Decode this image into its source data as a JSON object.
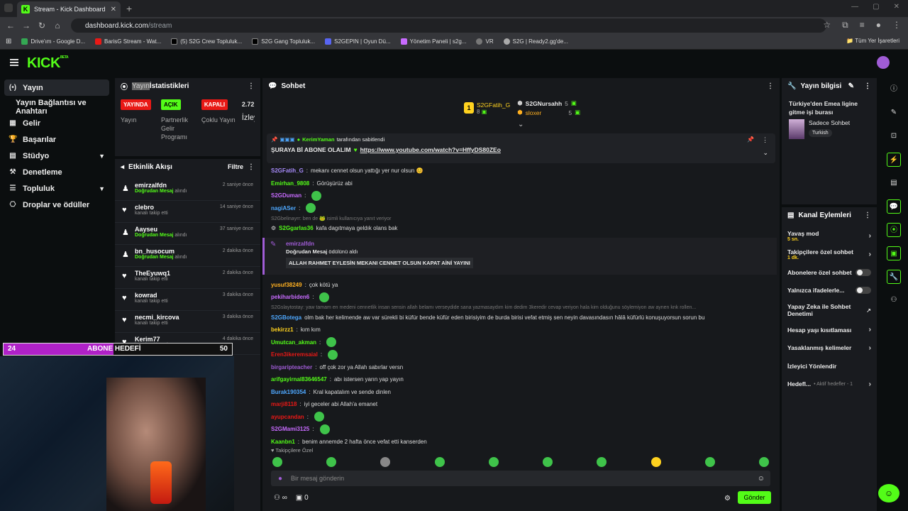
{
  "browser": {
    "tab_title": "Stream - Kick Dashboard",
    "url_host": "dashboard.kick.com",
    "url_path": "/stream",
    "bookmarks": [
      "Drive'ım - Google D...",
      "BarisG Stream - Wat...",
      "(5) S2G Crew Topluluk...",
      "S2G Gang Topluluk...",
      "S2GEPIN | Oyun Dü...",
      "Yönetim Paneli | s2g...",
      "VR",
      "S2G | Ready2.gg'de..."
    ],
    "all_bookmarks": "Tüm Yer İşaretleri"
  },
  "header": {
    "logo": "KICK",
    "logo_sup": "BETA"
  },
  "nav": {
    "items": [
      {
        "label": "Yayın",
        "icon": "(•)"
      },
      {
        "label": "Yayın Bağlantısı ve Anahtarı",
        "icon": ""
      },
      {
        "label": "Gelir",
        "icon": "▦"
      },
      {
        "label": "Başarılar",
        "icon": "🏆"
      },
      {
        "label": "Stüdyo",
        "icon": "▤"
      },
      {
        "label": "Denetleme",
        "icon": "⚒"
      },
      {
        "label": "Topluluk",
        "icon": "☰"
      },
      {
        "label": "Droplar ve ödüller",
        "icon": "⎔"
      }
    ]
  },
  "stats": {
    "title_dim": "Yayın",
    "title": "İstatistikleri",
    "badges": [
      {
        "text": "YAYINDA",
        "bg": "#e91916",
        "fg": "#ffffff",
        "label": "Yayın"
      },
      {
        "text": "AÇIK",
        "bg": "#53fc18",
        "fg": "#000000",
        "label": "Partnerlik Gelir Programı"
      },
      {
        "text": "KAPALI",
        "bg": "#e91916",
        "fg": "#ffffff",
        "label": "Çoklu Yayın"
      }
    ],
    "viewers_value": "2.72",
    "viewers_label": "İzley"
  },
  "feed": {
    "title": "Etkinlik Akışı",
    "filter": "Filtre",
    "items": [
      {
        "name": "emirzalfdn",
        "sub_g": "Doğrudan Mesaj",
        "sub": " alındı",
        "time": "2 saniye önce",
        "icon": "♟"
      },
      {
        "name": "clebro",
        "sub_g": "",
        "sub": "kanalı takip etti",
        "time": "14 saniye önce",
        "icon": "♥"
      },
      {
        "name": "Aayseu",
        "sub_g": "Doğrudan Mesaj",
        "sub": " alındı",
        "time": "37 saniye önce",
        "icon": "♟"
      },
      {
        "name": "bn_husocum",
        "sub_g": "Doğrudan Mesaj",
        "sub": " alındı",
        "time": "2 dakika önce",
        "icon": "♟"
      },
      {
        "name": "TheEyuwq1",
        "sub_g": "",
        "sub": "kanalı takip etti",
        "time": "2 dakika önce",
        "icon": "♥"
      },
      {
        "name": "kowrad",
        "sub_g": "",
        "sub": "kanalı takip etti",
        "time": "3 dakika önce",
        "icon": "♥"
      },
      {
        "name": "necmi_kircova",
        "sub_g": "",
        "sub": "kanalı takip etti",
        "time": "3 dakika önce",
        "icon": "♥"
      },
      {
        "name": "Kerim77",
        "sub_g": "",
        "sub": "kanalı takip etti",
        "time": "4 dakika önce",
        "icon": "♥"
      }
    ]
  },
  "goal": {
    "current": "24",
    "label": "ABONE HEDEFİ",
    "target": "50",
    "progress": 0.48,
    "color": "#b021c8"
  },
  "chat": {
    "title": "Sohbet",
    "top": [
      {
        "name": "S2GFatih_G",
        "count": "8",
        "color": "#ffd21f"
      },
      {
        "name": "S2GNursahh",
        "count": "5",
        "color": "#ffffff"
      },
      {
        "name": "sloxer",
        "count": "5",
        "color": "#ffb020"
      }
    ],
    "pinned_by": "KerimYaman",
    "pinned_by_suffix": " tarafından sabitlendi",
    "pinned_text": "ŞURAYA Bİ ABONE OLALIM",
    "pinned_link": "https://www.youtube.com/watch?v=HffyDS80ZEo",
    "messages1": [
      {
        "user": "S2GFatih_G",
        "color": "#a78bfa",
        "text": "mekanı cennet olsun yattığı yer nur olsun 😊"
      },
      {
        "user": "Emirhan_9808",
        "color": "#53fc18",
        "text": "Görüşürüz abi"
      },
      {
        "user": "S2GDuman",
        "color": "#c86bff",
        "text": ""
      },
      {
        "user": "nagiASer",
        "color": "#4ea8ff",
        "text": ""
      }
    ],
    "reply1": "S2Gbelinayrr: ben de 🐸 isimli kullanıcıya yanıt veriyor",
    "msg_garlas": {
      "user": "S2Ggarlas36",
      "color": "#53fc18",
      "text": "kafa dagıtmaya geldık olans bak"
    },
    "highlight_user": "emirzalfdn",
    "highlight_line": "Doğrudan Mesaj",
    "highlight_line_suffix": " ödülünü aldı",
    "highlight_msg": "ALLAH RAHMET EYLESİN MEKANI CENNET OLSUN KAPAT AİNİ YAYINI",
    "messages2": [
      {
        "user": "yusuf38249",
        "color": "#ffb020",
        "text": "çok kötü ya"
      },
      {
        "user": "pekiharbiden6",
        "color": "#c86bff",
        "text": ""
      }
    ],
    "reply2": "S2Gslaytostay: yaw tamam en medeni cennetlik insan sensin allah belamı verseydide sana yazmasaydım kim dedim 3keredir cevap veriyon hala kim olduğunu söylemiyon aw aynen knk rollen...",
    "msg_botega": {
      "user": "S2GBotega",
      "color": "#4ea8ff",
      "text": "olm bak her kelimende aw var sürekli bi küfür bende küfür eden birisiyim de burda birisi vefat etmiş sen neyin davasındasın hâlâ küfürlü konuşuyorsun sorun bu"
    },
    "messages3": [
      {
        "user": "bekirzz1",
        "color": "#ffd21f",
        "text": "kım kım"
      },
      {
        "user": "Umutcan_akman",
        "color": "#53fc18",
        "text": ""
      },
      {
        "user": "Eren3ikeremsaial",
        "color": "#e91916",
        "text": ""
      },
      {
        "user": "birgaripteacher",
        "color": "#a05cd6",
        "text": "off çok zor ya Allah sabırlar versn"
      },
      {
        "user": "arifgayirnal83646547",
        "color": "#53fc18",
        "text": "abı istersen yarın yap yayın"
      },
      {
        "user": "Burak190354",
        "color": "#4ea8ff",
        "text": "Kral kapatalım ve sende dinlen"
      },
      {
        "user": "marji8118",
        "color": "#e91916",
        "text": "iyi geceler abi Allah'a emanet"
      },
      {
        "user": "ayupcandan",
        "color": "#e91916",
        "text": ""
      },
      {
        "user": "S2GMami3125",
        "color": "#c86bff",
        "text": ""
      },
      {
        "user": "Kaanbn1",
        "color": "#53fc18",
        "text": "benim annemde 2 hafta önce vefat etti kanserden"
      }
    ],
    "followers_only": "Takipçilere Özel",
    "input_placeholder": "Bir mesaj gönderin",
    "send": "Gönder"
  },
  "stream_info": {
    "title": "Yayın bilgisi",
    "stream_title": "Türkiye'den Emea ligine gitme işi burası",
    "category": "Sadece Sohbet",
    "tag": "Turkish"
  },
  "channel_actions": {
    "title": "Kanal Eylemleri",
    "slow_mode": "Yavaş mod",
    "slow_mode_value": "5 sn.",
    "followers_chat": "Takipçilere özel sohbet",
    "followers_chat_value": "1 dk.",
    "subs_only": "Abonelere özel sohbet",
    "emotes_only": "Yalnızca ifadelerle...",
    "ai_moderation": "Yapay Zeka ile Sohbet Denetimi",
    "age_restriction": "Hesap yaşı kısıtlaması",
    "banned_words": "Yasaklanmış kelimeler",
    "viewer_redirect": "İzleyici Yönlendir",
    "goals": "Hedefl...",
    "goals_sub": "• Aktif hedefler - 1"
  },
  "colors": {
    "accent": "#53fc18",
    "panel": "#191b1f",
    "bg": "#0b0e0f"
  }
}
